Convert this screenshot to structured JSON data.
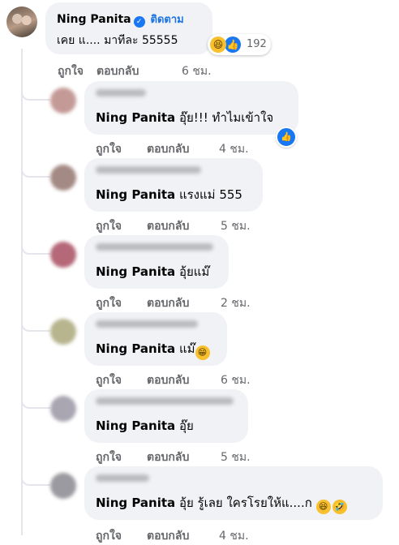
{
  "root_comment": {
    "author": "Ning Panita",
    "follow_label": "ติดตาม",
    "text": "เคย แ.... มาทีละ 55555",
    "reaction_count": "192",
    "like_label": "ถูกใจ",
    "reply_label": "ตอบกลับ",
    "time": "6 ชม."
  },
  "replies": [
    {
      "text_prefix": "Ning Panita",
      "text": "อุ๊ย!!! ทำไมเข้าใจ",
      "like_label": "ถูกใจ",
      "reply_label": "ตอบกลับ",
      "time": "4 ชม.",
      "has_like_reaction": true
    },
    {
      "text_prefix": "Ning Panita",
      "text": "แรงแม่ 555",
      "like_label": "ถูกใจ",
      "reply_label": "ตอบกลับ",
      "time": "5 ชม."
    },
    {
      "text_prefix": "Ning Panita",
      "text": "อุ้ยแม๊",
      "like_label": "ถูกใจ",
      "reply_label": "ตอบกลับ",
      "time": "2 ชม."
    },
    {
      "text_prefix": "Ning Panita",
      "text": "แม๊",
      "like_label": "ถูกใจ",
      "reply_label": "ตอบกลับ",
      "time": "6 ชม.",
      "emoji": "grin"
    },
    {
      "text_prefix": "Ning Panita",
      "text": "อุ๊ย",
      "like_label": "ถูกใจ",
      "reply_label": "ตอบกลับ",
      "time": "5 ชม."
    },
    {
      "text_prefix": "Ning Panita",
      "text": "อุ้ย รู้เลย ใครโรยให้แ....ก",
      "like_label": "ถูกใจ",
      "reply_label": "ตอบกลับ",
      "time": "4 ชม.",
      "emoji": "haha-rofl"
    }
  ],
  "icons": {
    "verified": "verified-badge-icon",
    "haha": "haha-reaction-icon",
    "like": "like-reaction-icon"
  },
  "colors": {
    "bubble": "#f0f2f5",
    "link": "#1b74e4",
    "meta": "#65676b",
    "like_blue": "#1877f2"
  }
}
